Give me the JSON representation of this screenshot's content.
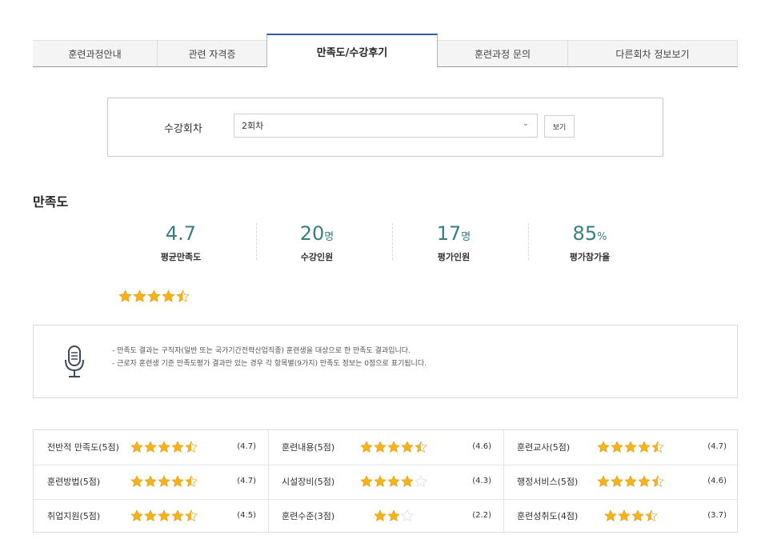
{
  "tabs": [
    {
      "label": "훈련과정안내",
      "active": false
    },
    {
      "label": "관련 자격증",
      "active": false
    },
    {
      "label": "만족도/수강후기",
      "active": true
    },
    {
      "label": "훈련과정 문의",
      "active": false
    },
    {
      "label": "다른회차 정보보기",
      "active": false
    }
  ],
  "session": {
    "label": "수강회차",
    "selected": "2회차",
    "view_button": "보기"
  },
  "satisfaction": {
    "title": "만족도",
    "stats": [
      {
        "value": "4.7",
        "unit": "",
        "label": "평균만족도"
      },
      {
        "value": "20",
        "unit": "명",
        "label": "수강인원"
      },
      {
        "value": "17",
        "unit": "명",
        "label": "평가인원"
      },
      {
        "value": "85",
        "unit": "%",
        "label": "평가참가율"
      }
    ],
    "average_stars": 4.7,
    "average_max": 5
  },
  "notice": {
    "icon": "microphone-icon",
    "lines": [
      "- 만족도 결과는 구직자(일반 또는 국가기간전략산업직종) 훈련생을 대상으로 한 만족도 결과입니다.",
      "- 근로자 훈련생 기준 만족도평가 결과만 있는 경우 각 항목별(9가지) 만족도 정보는 0점으로 표기됩니다."
    ]
  },
  "ratings": [
    {
      "label": "전반적 만족도(5점)",
      "score": 4.7,
      "max": 5,
      "value": "(4.7)"
    },
    {
      "label": "훈련내용(5점)",
      "score": 4.6,
      "max": 5,
      "value": "(4.6)"
    },
    {
      "label": "훈련교사(5점)",
      "score": 4.7,
      "max": 5,
      "value": "(4.7)"
    },
    {
      "label": "훈련방법(5점)",
      "score": 4.7,
      "max": 5,
      "value": "(4.7)"
    },
    {
      "label": "시설장비(5점)",
      "score": 4.3,
      "max": 5,
      "value": "(4.3)"
    },
    {
      "label": "행정서비스(5점)",
      "score": 4.6,
      "max": 5,
      "value": "(4.6)"
    },
    {
      "label": "취업지원(5점)",
      "score": 4.5,
      "max": 5,
      "value": "(4.5)"
    },
    {
      "label": "훈련수준(3점)",
      "score": 2.2,
      "max": 3,
      "value": "(2.2)"
    },
    {
      "label": "훈련성취도(4점)",
      "score": 3.7,
      "max": 4,
      "value": "(3.7)"
    }
  ],
  "colors": {
    "accent": "#2f5faa",
    "stat_value": "#3a7f80",
    "star_fill": "#f5b21b",
    "star_empty": "#d8d8d8"
  }
}
